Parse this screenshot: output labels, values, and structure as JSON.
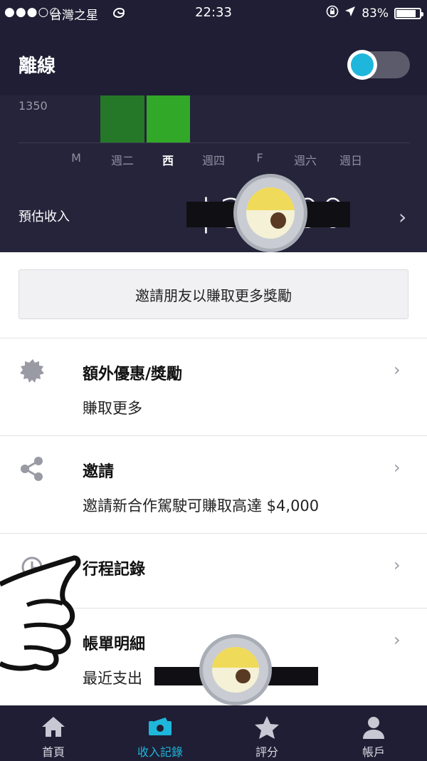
{
  "status_bar": {
    "signal": "●●●○○",
    "carrier": "台灣之星",
    "time": "22:33",
    "battery": "83%"
  },
  "header": {
    "title": "離線",
    "toggle_on": true
  },
  "chart_data": {
    "type": "bar",
    "ytick": "1350",
    "categories": [
      "M",
      "週二",
      "西",
      "週四",
      "F",
      "週六",
      "週日"
    ],
    "active_category": "西",
    "bar_colors": [
      "#257827",
      "#31a828"
    ]
  },
  "earnings": {
    "label": "預估收入",
    "value": "$3 3.00"
  },
  "invite_banner": {
    "label": "邀請朋友以賺取更多獎勵"
  },
  "list": [
    {
      "title": "額外優惠/獎勵",
      "subtitle": "賺取更多",
      "icon": "badge-icon"
    },
    {
      "title": "邀請",
      "subtitle": "邀請新合作駕駛可賺取高達 $4,000",
      "icon": "share-icon"
    },
    {
      "title": "行程記錄",
      "subtitle": "",
      "icon": "clock-history-icon"
    },
    {
      "title": "帳單明細",
      "subtitle": "最近支出",
      "icon": ""
    }
  ],
  "tabs": [
    {
      "label": "首頁",
      "icon": "home-icon",
      "active": false
    },
    {
      "label": "收入記錄",
      "icon": "cash-icon",
      "active": true
    },
    {
      "label": "評分",
      "icon": "star-icon",
      "active": false
    },
    {
      "label": "帳戶",
      "icon": "person-icon",
      "active": false
    }
  ],
  "colors": {
    "dark": "#1f1e34",
    "panel": "#25243a",
    "accent": "#1fb6db"
  }
}
